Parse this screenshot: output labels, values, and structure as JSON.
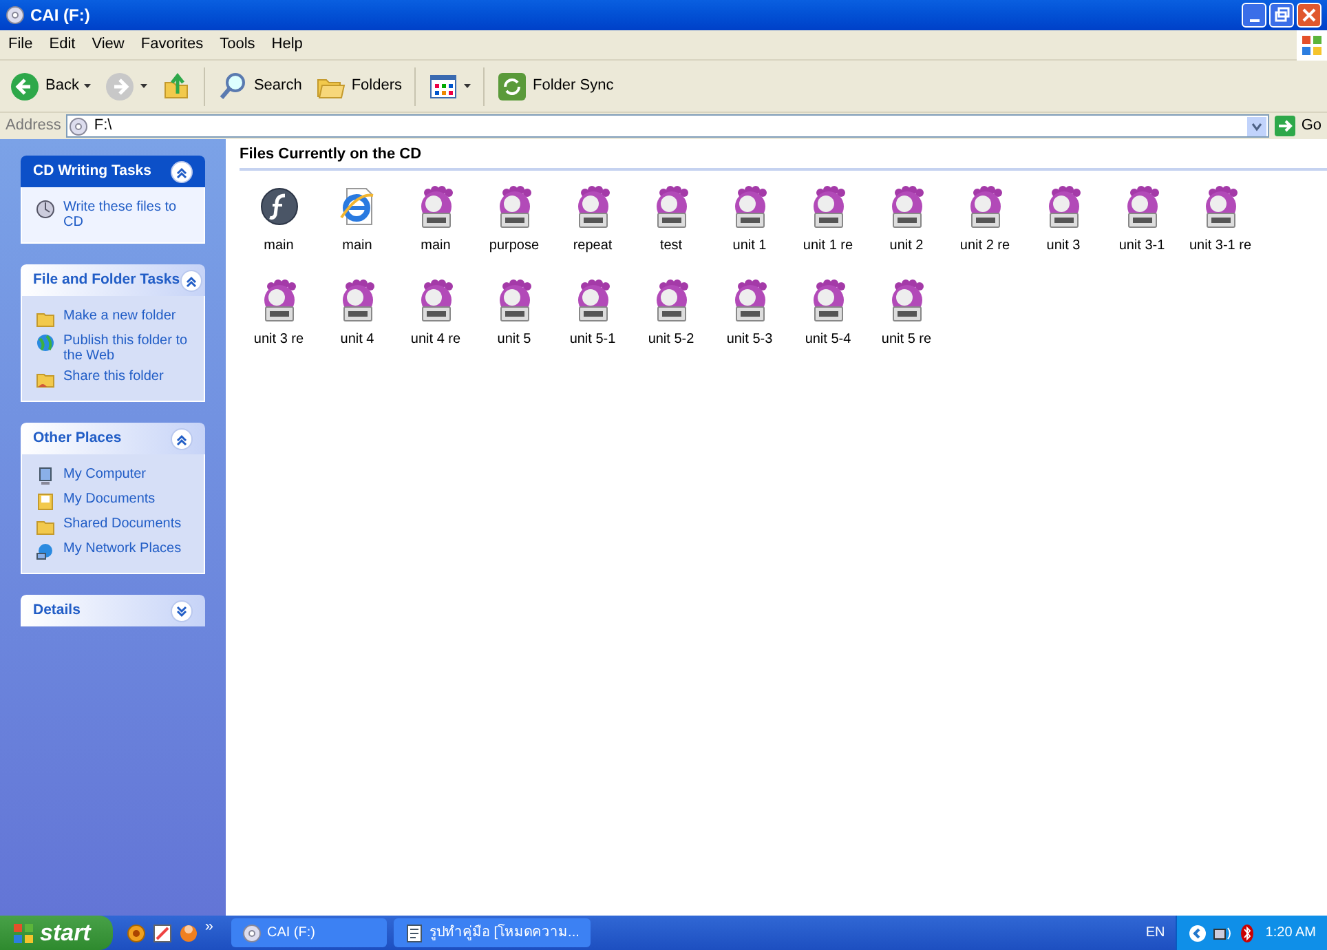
{
  "window": {
    "title": "CAI (F:)"
  },
  "menu": [
    "File",
    "Edit",
    "View",
    "Favorites",
    "Tools",
    "Help"
  ],
  "toolbar": [
    {
      "kind": "back",
      "label": "Back"
    },
    {
      "kind": "forward"
    },
    {
      "kind": "up"
    },
    {
      "kind": "search",
      "label": "Search"
    },
    {
      "kind": "folders",
      "label": "Folders"
    },
    {
      "kind": "views"
    },
    {
      "kind": "sync",
      "label": "Folder Sync"
    }
  ],
  "address": {
    "label": "Address",
    "value": "F:\\",
    "go": "Go"
  },
  "panels": [
    {
      "title": "CD Writing Tasks",
      "expanded": true,
      "special": true,
      "items": [
        {
          "kind": "burn",
          "label": "Write these files to CD"
        }
      ]
    },
    {
      "title": "File and Folder Tasks",
      "expanded": true,
      "special": false,
      "items": [
        {
          "kind": "newfolder",
          "label": "Make a new folder"
        },
        {
          "kind": "web",
          "label": "Publish this folder to the Web"
        },
        {
          "kind": "share",
          "label": "Share this folder"
        }
      ]
    },
    {
      "title": "Other Places",
      "expanded": true,
      "special": false,
      "items": [
        {
          "kind": "computer",
          "label": "My Computer"
        },
        {
          "kind": "documents",
          "label": "My Documents"
        },
        {
          "kind": "folder",
          "label": "Shared Documents"
        },
        {
          "kind": "network",
          "label": "My Network Places"
        }
      ]
    },
    {
      "title": "Details",
      "expanded": false,
      "special": false
    }
  ],
  "content": {
    "heading": "Files Currently on the CD",
    "files": [
      {
        "kind": "flash",
        "name": "main"
      },
      {
        "kind": "html",
        "name": "main"
      },
      {
        "kind": "swf",
        "name": "main"
      },
      {
        "kind": "swf",
        "name": "purpose"
      },
      {
        "kind": "swf",
        "name": "repeat"
      },
      {
        "kind": "swf",
        "name": "test"
      },
      {
        "kind": "swf",
        "name": "unit 1"
      },
      {
        "kind": "swf",
        "name": "unit 1 re"
      },
      {
        "kind": "swf",
        "name": "unit 2"
      },
      {
        "kind": "swf",
        "name": "unit 2 re"
      },
      {
        "kind": "swf",
        "name": "unit 3"
      },
      {
        "kind": "swf",
        "name": "unit 3-1"
      },
      {
        "kind": "swf",
        "name": "unit 3-1 re"
      },
      {
        "kind": "swf",
        "name": "unit 3 re"
      },
      {
        "kind": "swf",
        "name": "unit 4"
      },
      {
        "kind": "swf",
        "name": "unit 4 re"
      },
      {
        "kind": "swf",
        "name": "unit 5"
      },
      {
        "kind": "swf",
        "name": "unit 5-1"
      },
      {
        "kind": "swf",
        "name": "unit 5-2"
      },
      {
        "kind": "swf",
        "name": "unit 5-3"
      },
      {
        "kind": "swf",
        "name": "unit 5-4"
      },
      {
        "kind": "swf",
        "name": "unit 5 re"
      }
    ]
  },
  "taskbar": {
    "start": "start",
    "tasks": [
      {
        "kind": "drive",
        "label": "CAI (F:)"
      },
      {
        "kind": "document",
        "label": "รูปทำคู่มือ [โหมดความ..."
      }
    ],
    "more": "»",
    "language": "EN",
    "clock": "1:20 AM"
  }
}
